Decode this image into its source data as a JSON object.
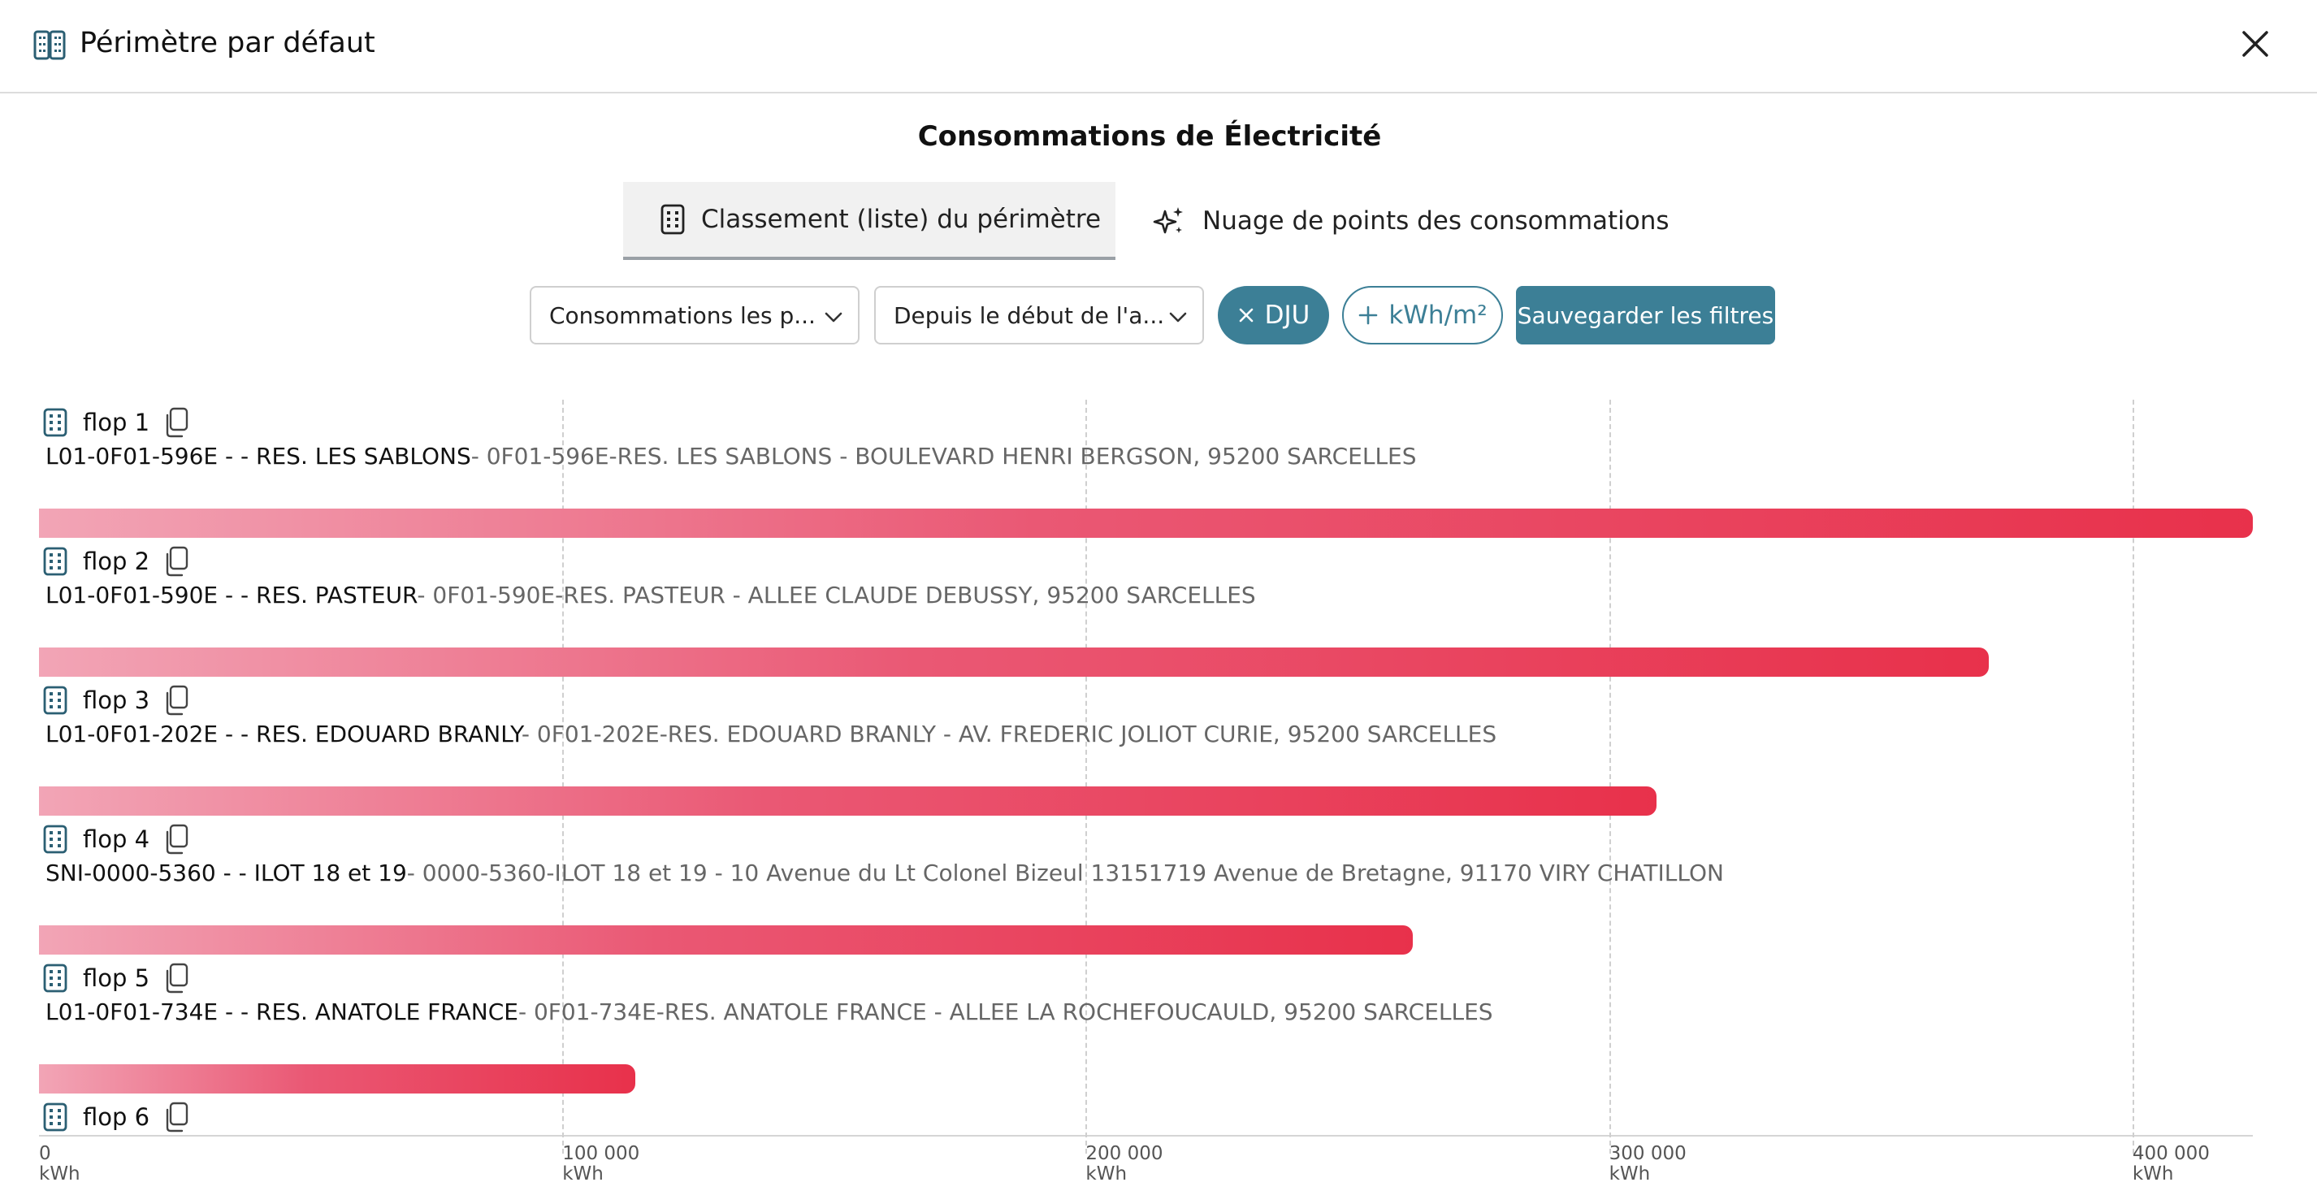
{
  "header": {
    "title": "Périmètre par défaut"
  },
  "chart_title": "Consommations de Électricité",
  "tabs": [
    {
      "label": "Classement (liste) du périmètre",
      "active": true
    },
    {
      "label": "Nuage de points des consommations",
      "active": false
    }
  ],
  "filters": {
    "select_1": "Consommations les p...",
    "select_2": "Depuis le début de l'a...",
    "chip_dju": "DJU",
    "chip_kwh": "kWh/m²",
    "save_label": "Sauvegarder les filtres"
  },
  "colors": {
    "accent": "#3c7f96",
    "bar_start": "#f2a5b6",
    "bar_end": "#e8314b"
  },
  "chart_data": {
    "type": "bar",
    "orientation": "horizontal",
    "xlim": [
      0,
      423000
    ],
    "x_ticks": [
      "0",
      "100 000",
      "200 000",
      "300 000",
      "400 000"
    ],
    "x_tick_values": [
      0,
      100000,
      200000,
      300000,
      400000
    ],
    "x_unit": "kWh",
    "grid": true,
    "items": [
      {
        "rank": "flop 1",
        "code": "L01-0F01-596E - - RES. LES SABLONS",
        "address": "- 0F01-596E-RES. LES SABLONS - BOULEVARD HENRI BERGSON, 95200 SARCELLES",
        "value": 423000
      },
      {
        "rank": "flop 2",
        "code": "L01-0F01-590E - - RES. PASTEUR",
        "address": "- 0F01-590E-RES. PASTEUR - ALLEE CLAUDE DEBUSSY, 95200 SARCELLES",
        "value": 372500
      },
      {
        "rank": "flop 3",
        "code": "L01-0F01-202E - - RES. EDOUARD BRANLY",
        "address": "- 0F01-202E-RES. EDOUARD BRANLY - AV. FREDERIC JOLIOT CURIE, 95200 SARCELLES",
        "value": 309000
      },
      {
        "rank": "flop 4",
        "code": "SNI-0000-5360 - - ILOT 18 et 19",
        "address": "- 0000-5360-ILOT 18 et 19 - 10 Avenue du Lt Colonel Bizeul 13151719 Avenue de Bretagne, 91170 VIRY CHATILLON",
        "value": 262500
      },
      {
        "rank": "flop 5",
        "code": "L01-0F01-734E - - RES. ANATOLE FRANCE",
        "address": "- 0F01-734E-RES. ANATOLE FRANCE - ALLEE LA ROCHEFOUCAULD, 95200 SARCELLES",
        "value": 114000
      },
      {
        "rank": "flop 6",
        "code": "",
        "address": "",
        "value": null
      }
    ]
  }
}
